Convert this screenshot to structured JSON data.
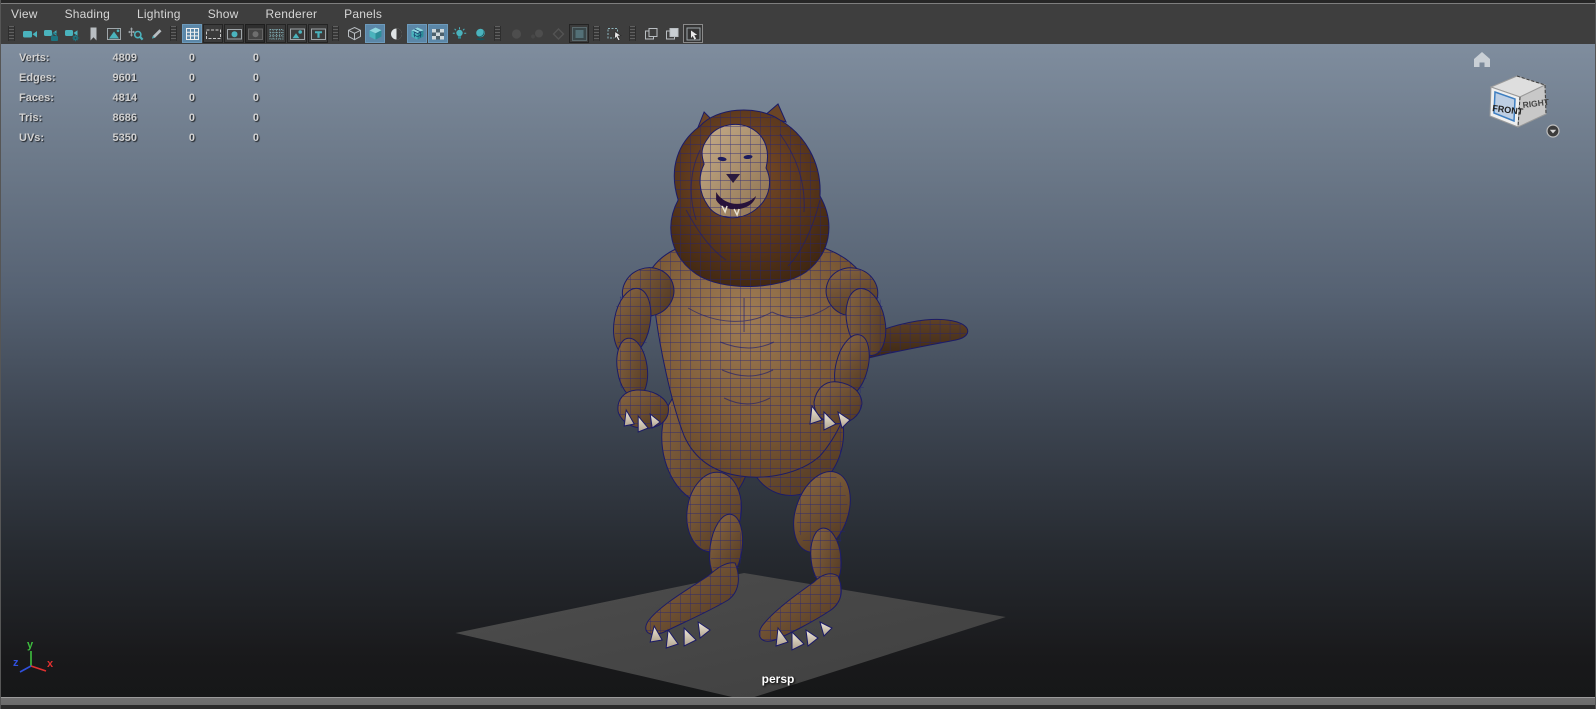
{
  "menu_bar": {
    "items": [
      "View",
      "Shading",
      "Lighting",
      "Show",
      "Renderer",
      "Panels"
    ]
  },
  "toolbar": {
    "icons": [
      {
        "name": "camera-icon"
      },
      {
        "name": "camera-lock-icon"
      },
      {
        "name": "camera-attributes-icon"
      },
      {
        "name": "bookmark-icon"
      },
      {
        "name": "image-plane-icon"
      },
      {
        "name": "pan-zoom-icon"
      },
      {
        "name": "grease-pencil-icon"
      },
      {
        "name": "grid-icon",
        "active": true
      },
      {
        "name": "film-gate-icon"
      },
      {
        "name": "resolution-gate-icon"
      },
      {
        "name": "gate-mask-icon",
        "pressed": true
      },
      {
        "name": "field-chart-icon"
      },
      {
        "name": "safe-action-icon"
      },
      {
        "name": "safe-title-icon"
      },
      {
        "name": "wireframe-icon"
      },
      {
        "name": "smooth-shade-icon",
        "active": true
      },
      {
        "name": "textured-icon"
      },
      {
        "name": "wireframe-on-shaded-icon",
        "active": true
      },
      {
        "name": "xray-icon",
        "active": true
      },
      {
        "name": "lights-icon"
      },
      {
        "name": "shadows-icon"
      },
      {
        "name": "ambient-occlusion-icon",
        "disabled": true
      },
      {
        "name": "motion-blur-icon",
        "disabled": true
      },
      {
        "name": "depth-of-field-icon",
        "disabled": true
      },
      {
        "name": "multisample-icon"
      },
      {
        "name": "select-tool-icon"
      },
      {
        "name": "tear-off-icon"
      },
      {
        "name": "tear-off-copy-icon"
      },
      {
        "name": "isolate-select-icon"
      }
    ]
  },
  "hud": {
    "rows": [
      {
        "label": "Verts:",
        "value": "4809",
        "col2": "0",
        "col3": "0"
      },
      {
        "label": "Edges:",
        "value": "9601",
        "col2": "0",
        "col3": "0"
      },
      {
        "label": "Faces:",
        "value": "4814",
        "col2": "0",
        "col3": "0"
      },
      {
        "label": "Tris:",
        "value": "8686",
        "col2": "0",
        "col3": "0"
      },
      {
        "label": "UVs:",
        "value": "5350",
        "col2": "0",
        "col3": "0"
      }
    ]
  },
  "viewport": {
    "camera_label": "persp",
    "view_cube": {
      "front_label": "FRONT",
      "right_label": "RIGHT"
    },
    "axis": {
      "x_label": "x",
      "y_label": "y",
      "z_label": "z"
    },
    "scene_description": "anthropomorphic lion creature model shown wireframe-on-shaded, standing on a gray ground plane"
  },
  "colors": {
    "accent_active": "#5b87a8",
    "icon_teal": "#4ab3bd",
    "wireframe_blue": "#1e1e78",
    "body_brown": "#7b5936",
    "mane_brown": "#5a3519",
    "claw_ivory": "#e6dfcf",
    "viewport_top": "#7f8d9e",
    "viewport_bottom": "#161718",
    "ground_gray": "#474747",
    "toolbar_bg": "#3e3e3e"
  }
}
